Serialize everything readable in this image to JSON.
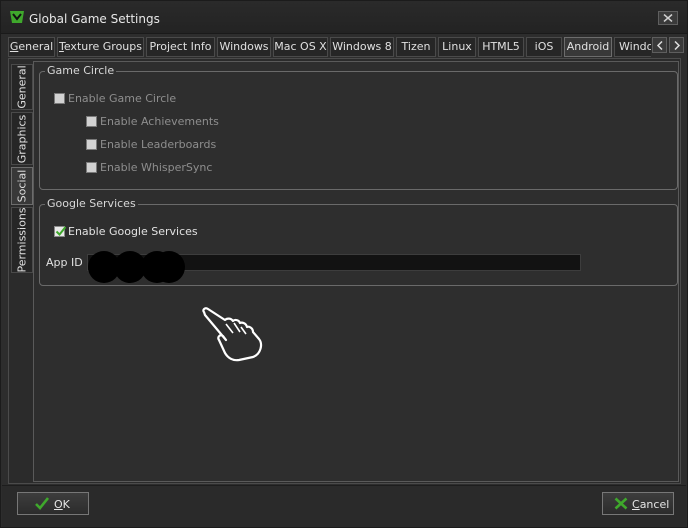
{
  "window": {
    "title": "Global Game Settings"
  },
  "platform_tabs": [
    {
      "label": "General",
      "underline": "G",
      "rest": "eneral"
    },
    {
      "label": "Texture Groups",
      "underline": "T",
      "rest": "exture Groups"
    },
    {
      "label": "Project Info",
      "underline": "",
      "rest": "Project Info"
    },
    {
      "label": "Windows"
    },
    {
      "label": "Mac OS X"
    },
    {
      "label": "Windows 8"
    },
    {
      "label": "Tizen"
    },
    {
      "label": "Linux"
    },
    {
      "label": "HTML5"
    },
    {
      "label": "iOS"
    },
    {
      "label": "Android"
    },
    {
      "label": "Window"
    }
  ],
  "side_tabs": [
    {
      "label": "General"
    },
    {
      "label": "Graphics"
    },
    {
      "label": "Social"
    },
    {
      "label": "Permissions"
    }
  ],
  "game_circle": {
    "title": "Game Circle",
    "enable_label": "Enable Game Circle",
    "options": [
      "Enable Achievements",
      "Enable Leaderboards",
      "Enable WhisperSync"
    ]
  },
  "google_services": {
    "title": "Google Services",
    "enable_label": "Enable Google Services",
    "enabled": true,
    "app_id_label": "App ID",
    "app_id_value": ""
  },
  "buttons": {
    "ok": {
      "underline": "O",
      "rest": "K"
    },
    "cancel": {
      "underline": "C",
      "rest": "ancel"
    }
  },
  "colors": {
    "accent_green": "#3fa82c",
    "background": "#2e2e2e"
  }
}
